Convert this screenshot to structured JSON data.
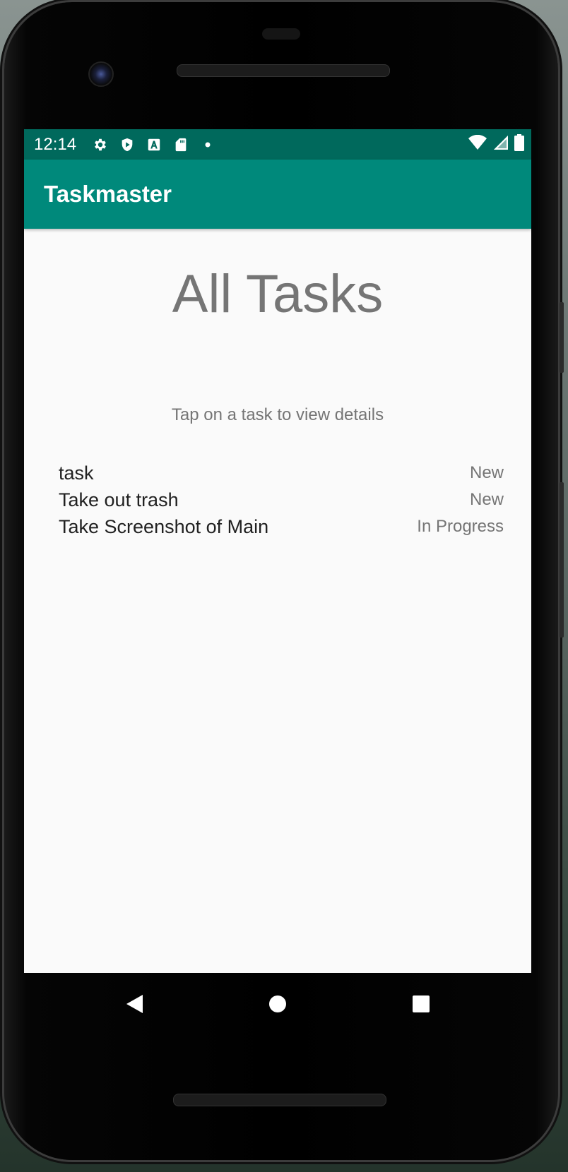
{
  "status_bar": {
    "time": "12:14",
    "icons": [
      "settings-icon",
      "play-protect-icon",
      "text-a-icon",
      "sd-card-icon",
      "dot-icon"
    ],
    "right_icons": [
      "wifi-icon",
      "signal-icon",
      "battery-icon"
    ]
  },
  "app_bar": {
    "title": "Taskmaster",
    "color": "#00897b",
    "status_color": "#00695c"
  },
  "main": {
    "heading": "All Tasks",
    "hint": "Tap on a task to view details",
    "tasks": [
      {
        "title": "task",
        "status": "New"
      },
      {
        "title": "Take out trash",
        "status": "New"
      },
      {
        "title": "Take Screenshot of Main",
        "status": "In Progress"
      }
    ]
  },
  "nav_bar": {
    "buttons": [
      "back-icon",
      "home-icon",
      "recents-icon"
    ]
  }
}
